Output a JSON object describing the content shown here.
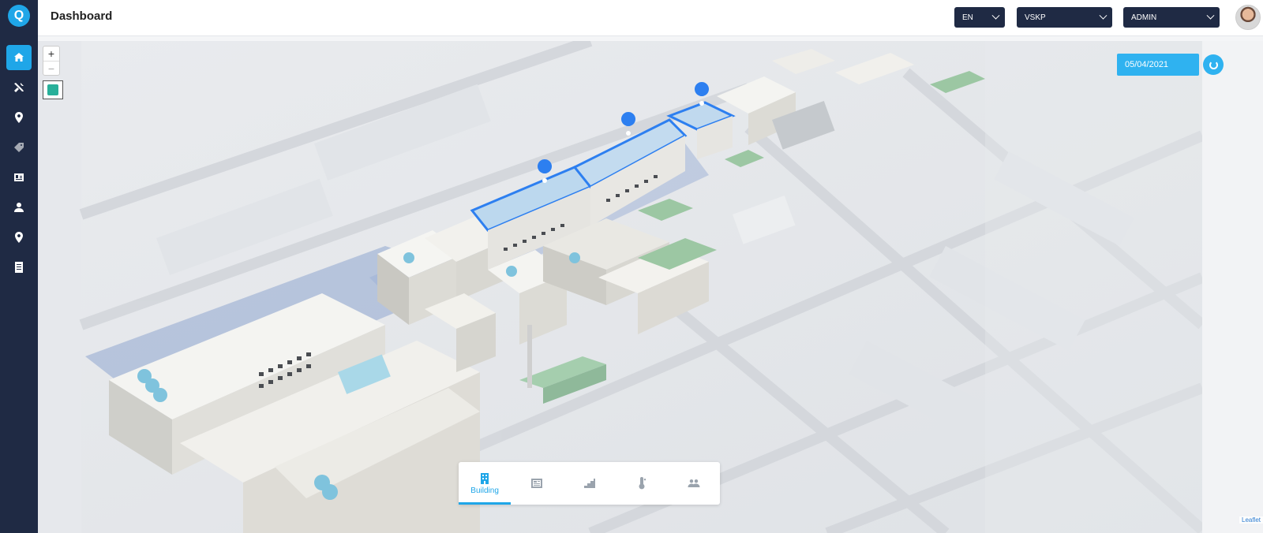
{
  "app": {
    "logo_icon": "search-logo-icon",
    "accent": "#1fa6e8"
  },
  "header": {
    "title": "Dashboard"
  },
  "selectors": {
    "language": "EN",
    "site": "VSKP",
    "user": "ADMIN"
  },
  "sidebar": {
    "items": [
      {
        "icon": "home-icon",
        "active": true
      },
      {
        "icon": "tools-icon"
      },
      {
        "icon": "location-pin-icon"
      },
      {
        "icon": "tag-icon"
      },
      {
        "icon": "id-card-icon"
      },
      {
        "icon": "user-icon"
      },
      {
        "icon": "location-pin-icon"
      },
      {
        "icon": "document-icon"
      }
    ]
  },
  "map": {
    "zoom_in": "+",
    "zoom_out": "−",
    "date": "05/04/2021",
    "attribution": "Leaflet"
  },
  "bottom_tabs": [
    {
      "icon": "building-icon",
      "label": "Building",
      "active": true
    },
    {
      "icon": "panel-icon"
    },
    {
      "icon": "stairs-icon"
    },
    {
      "icon": "thermometer-icon"
    },
    {
      "icon": "people-icon"
    }
  ]
}
